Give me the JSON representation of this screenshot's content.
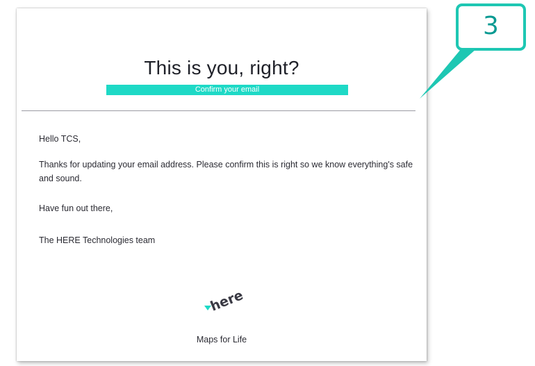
{
  "email": {
    "headline": "This is you, right?",
    "confirm_button_label": "Confirm your email",
    "greeting": "Hello TCS,",
    "paragraph": "Thanks for updating your email address. Please confirm this is right so we know everything's safe and sound.",
    "signoff": "Have fun out there,",
    "signature": "The HERE Technologies team",
    "logo_text": "here",
    "tagline": "Maps for Life"
  },
  "callout": {
    "number": "3"
  },
  "colors": {
    "accent": "#1ed9c6",
    "callout_border": "#1ec7b3",
    "callout_text": "#0a9a92",
    "heading_text": "#1f2129"
  }
}
